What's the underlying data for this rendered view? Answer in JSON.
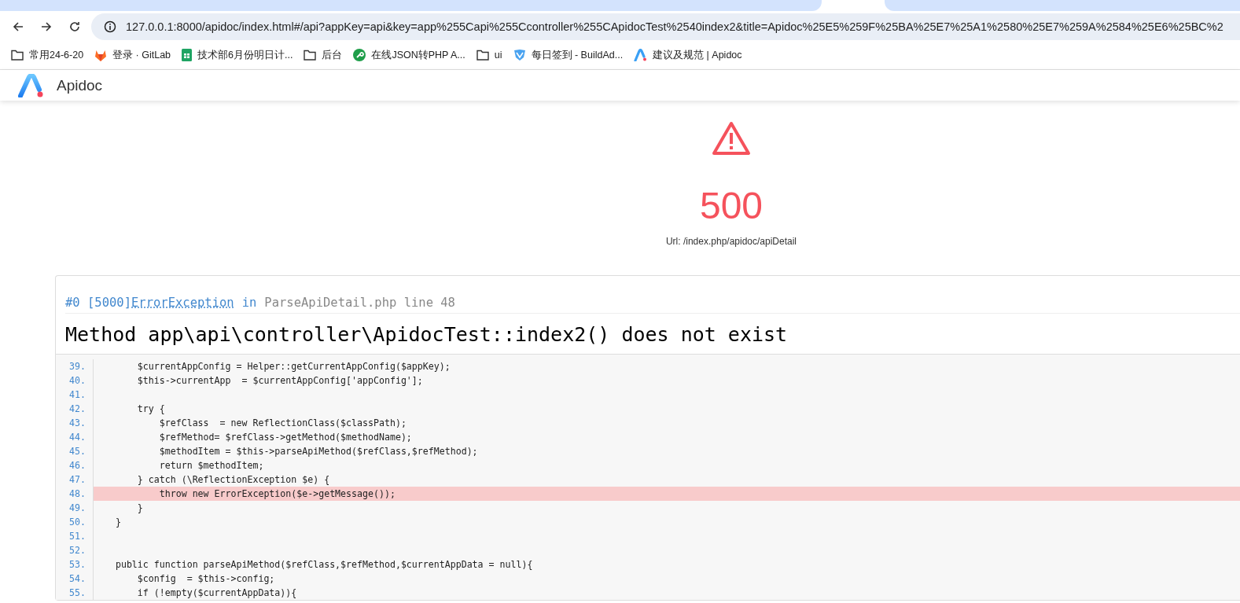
{
  "browser": {
    "url": "127.0.0.1:8000/apidoc/index.html#/api?appKey=api&key=app%255Capi%255Ccontroller%255CApidocTest%2540index2&title=Apidoc%25E5%259F%25BA%25E7%25A1%2580%25E7%259A%2584%25E6%25BC%2",
    "bookmarks": [
      {
        "label": "常用24-6-20",
        "kind": "folder"
      },
      {
        "label": "登录 · GitLab",
        "kind": "site"
      },
      {
        "label": "技术部6月份明日计...",
        "kind": "site"
      },
      {
        "label": "后台",
        "kind": "folder"
      },
      {
        "label": "在线JSON转PHP A...",
        "kind": "site"
      },
      {
        "label": "ui",
        "kind": "folder"
      },
      {
        "label": "每日签到 - BuildAd...",
        "kind": "site"
      },
      {
        "label": "建议及规范 | Apidoc",
        "kind": "site"
      }
    ]
  },
  "app": {
    "name": "Apidoc"
  },
  "error": {
    "code": "500",
    "url": "Url: /index.php/apidoc/apiDetail"
  },
  "trace": {
    "prefix": "#0 [5000]",
    "exception": "ErrorException",
    "in": "in",
    "file": "ParseApiDetail.php line 48",
    "message": "Method app\\api\\controller\\ApidocTest::index2() does not exist",
    "lines": [
      {
        "number": "39.",
        "code": "        $currentAppConfig = Helper::getCurrentAppConfig($appKey);",
        "highlighted": false
      },
      {
        "number": "40.",
        "code": "        $this->currentApp  = $currentAppConfig['appConfig'];",
        "highlighted": false
      },
      {
        "number": "41.",
        "highlighted": false
      },
      {
        "number": "42.",
        "code": "        try {",
        "highlighted": false
      },
      {
        "number": "43.",
        "code": "            $refClass  = new ReflectionClass($classPath);",
        "highlighted": false
      },
      {
        "number": "44.",
        "code": "            $refMethod= $refClass->getMethod($methodName);",
        "highlighted": false
      },
      {
        "number": "45.",
        "code": "            $methodItem = $this->parseApiMethod($refClass,$refMethod);",
        "highlighted": false
      },
      {
        "number": "46.",
        "code": "            return $methodItem;",
        "highlighted": false
      },
      {
        "number": "47.",
        "code": "        } catch (\\ReflectionException $e) {",
        "highlighted": false
      },
      {
        "number": "48.",
        "code": "            throw new ErrorException($e->getMessage());",
        "highlighted": true
      },
      {
        "number": "49.",
        "code": "        }",
        "highlighted": false
      },
      {
        "number": "50.",
        "code": "    }",
        "highlighted": false
      },
      {
        "number": "51.",
        "highlighted": false
      },
      {
        "number": "52.",
        "highlighted": false
      },
      {
        "number": "53.",
        "code": "    public function parseApiMethod($refClass,$refMethod,$currentAppData = null){",
        "highlighted": false
      },
      {
        "number": "54.",
        "code": "        $config  = $this->config;",
        "highlighted": false
      },
      {
        "number": "55.",
        "code": "        if (!empty($currentAppData)){",
        "highlighted": false
      }
    ]
  }
}
